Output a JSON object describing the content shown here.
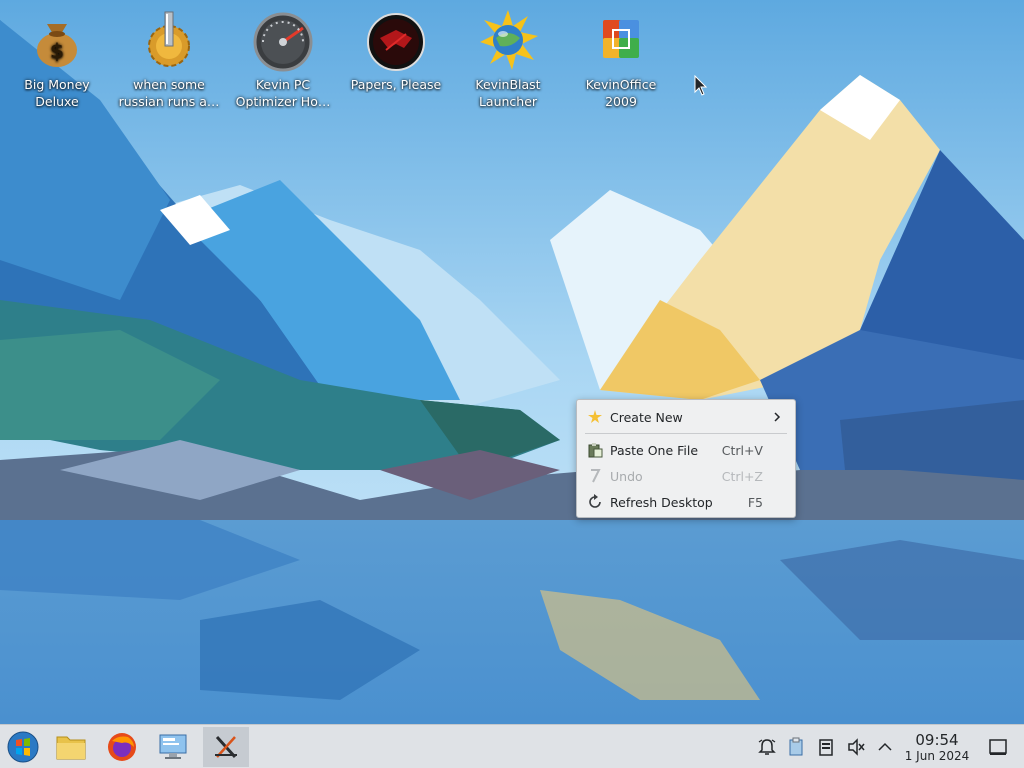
{
  "desktop": {
    "icons": [
      {
        "label": "Big Money Deluxe",
        "line1": "Big Money",
        "line2": "Deluxe"
      },
      {
        "label": "when some russian runs a...",
        "line1": "when some",
        "line2": "russian runs a…"
      },
      {
        "label": "Kevin PC Optimizer Ho...",
        "line1": "Kevin PC",
        "line2": "Optimizer Ho…"
      },
      {
        "label": "Papers, Please",
        "line1": "Papers, Please",
        "line2": ""
      },
      {
        "label": "KevinBlast Launcher",
        "line1": "KevinBlast",
        "line2": "Launcher"
      },
      {
        "label": "KevinOffice 2009",
        "line1": "KevinOffice",
        "line2": "2009"
      }
    ]
  },
  "context_menu": {
    "create_new": "Create New",
    "paste": {
      "label": "Paste One File",
      "shortcut": "Ctrl+V"
    },
    "undo": {
      "label": "Undo",
      "shortcut": "Ctrl+Z"
    },
    "refresh": {
      "label": "Refresh Desktop",
      "shortcut": "F5"
    }
  },
  "taskbar": {
    "apps": [
      "start-menu-icon",
      "file-manager-icon",
      "firefox-icon",
      "system-settings-icon",
      "x-app-icon"
    ],
    "tray": [
      "notifications-icon",
      "clipboard-icon",
      "device-icon",
      "volume-muted-icon",
      "chevron-up-icon"
    ],
    "clock": {
      "time": "09:54",
      "date": "1 Jun 2024"
    }
  },
  "colors": {
    "menu_bg": "#eff0f1",
    "taskbar_bg": "#dfe2e6",
    "sky_top": "#6db4e5"
  }
}
